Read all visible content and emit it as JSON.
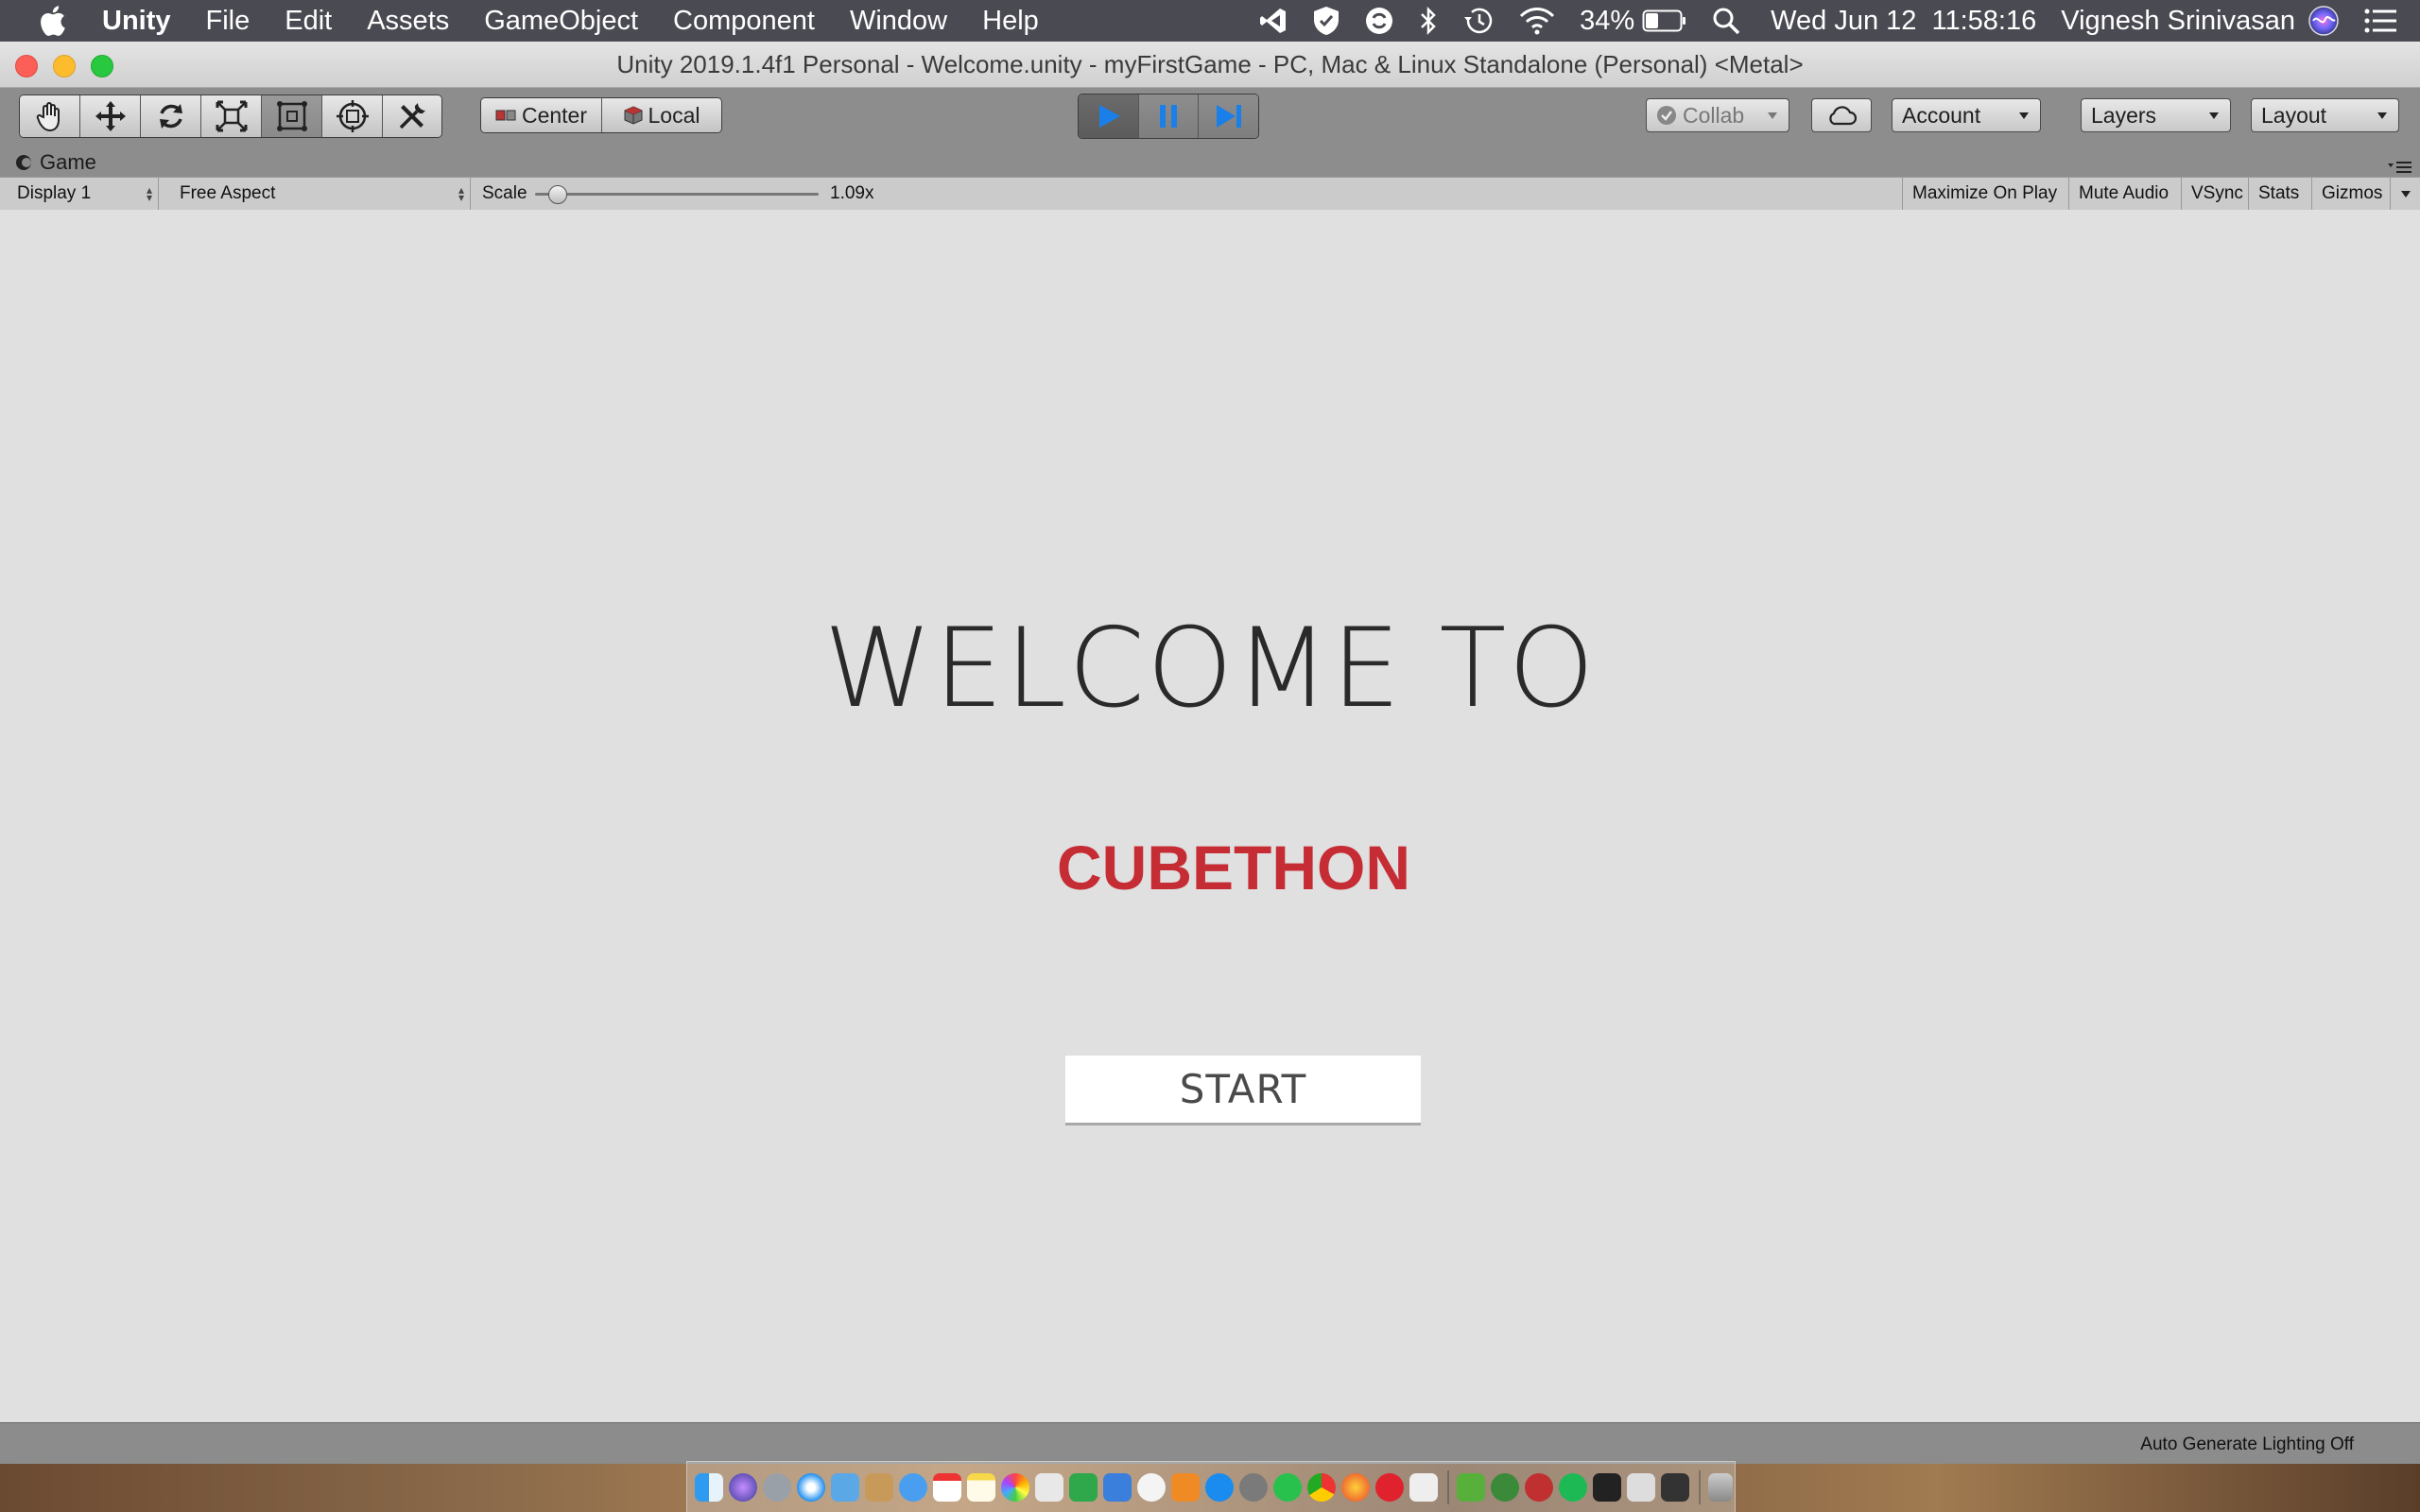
{
  "menubar": {
    "app_name": "Unity",
    "menus": [
      "File",
      "Edit",
      "Assets",
      "GameObject",
      "Component",
      "Window",
      "Help"
    ],
    "battery": "34%",
    "datetime": "Wed Jun 12  11:58:16",
    "user": "Vignesh Srinivasan"
  },
  "window": {
    "title": "Unity 2019.1.4f1 Personal - Welcome.unity - myFirstGame - PC, Mac & Linux Standalone (Personal) <Metal>"
  },
  "toolbar": {
    "pivot_label": "Center",
    "space_label": "Local",
    "collab_label": "Collab",
    "account_label": "Account",
    "layers_label": "Layers",
    "layout_label": "Layout"
  },
  "panel": {
    "tab_label": "Game",
    "display": "Display 1",
    "aspect": "Free Aspect",
    "scale_label": "Scale",
    "scale_value": "1.09x",
    "scale_fraction": 0.05,
    "maximize_label": "Maximize On Play",
    "mute_label": "Mute Audio",
    "vsync_label": "VSync",
    "stats_label": "Stats",
    "gizmos_label": "Gizmos"
  },
  "game": {
    "welcome_text": "WELCOME TO",
    "title": "CUBETHON",
    "start_label": "START",
    "title_color": "#c62c34"
  },
  "status": {
    "lighting": "Auto Generate Lighting Off"
  },
  "colors": {
    "play_accent": "#1a7fe8",
    "menubar_bg": "#4a4a52"
  }
}
